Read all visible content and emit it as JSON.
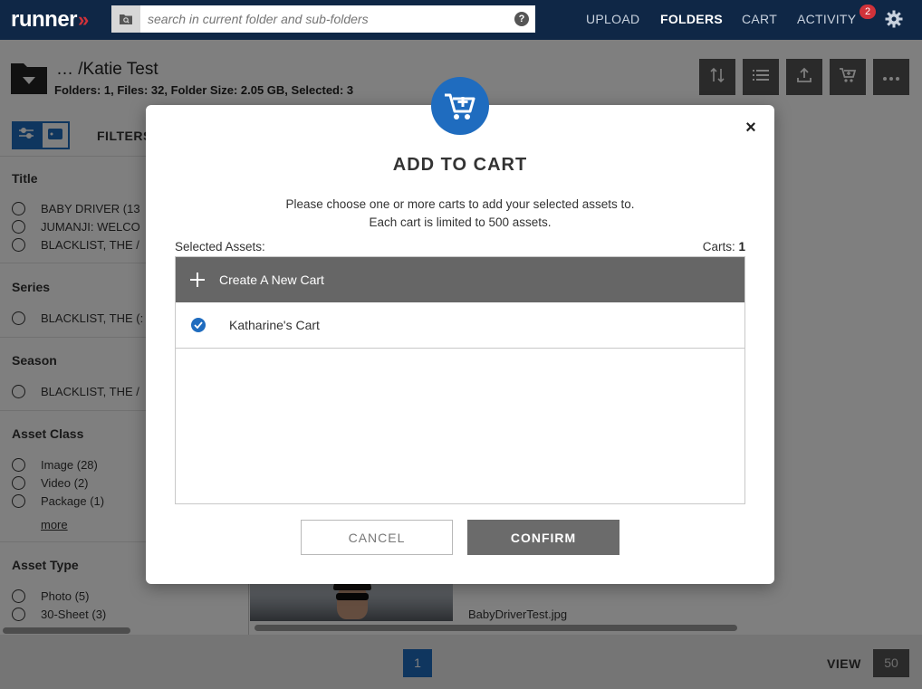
{
  "app": {
    "logo_text": "runner",
    "logo_chevrons": "»",
    "search_placeholder": "search in current folder and sub-folders",
    "search_help": "?",
    "nav": {
      "upload": "UPLOAD",
      "folders": "FOLDERS",
      "cart": "CART",
      "activity": "ACTIVITY",
      "activity_badge": "2"
    }
  },
  "header": {
    "path": "… /Katie Test",
    "stats": "Folders: 1, Files: 32, Folder Size: 2.05 GB, Selected: 3"
  },
  "sidebar": {
    "filters_label": "FILTERS",
    "facets": {
      "title": {
        "heading": "Title",
        "items": [
          "BABY DRIVER (13",
          "JUMANJI: WELCO",
          "BLACKLIST, THE /"
        ]
      },
      "series": {
        "heading": "Series",
        "items": [
          "BLACKLIST, THE (:"
        ]
      },
      "season": {
        "heading": "Season",
        "items": [
          "BLACKLIST, THE /"
        ]
      },
      "asset_class": {
        "heading": "Asset Class",
        "items": [
          "Image (28)",
          "Video (2)",
          "Package (1)"
        ],
        "more": "more"
      },
      "asset_type": {
        "heading": "Asset Type",
        "items": [
          "Photo (5)",
          "30-Sheet (3)"
        ]
      }
    }
  },
  "content": {
    "filename": "BabyDriverTest.jpg"
  },
  "footer": {
    "page": "1",
    "view_label": "VIEW",
    "view_value": "50"
  },
  "modal": {
    "title": "ADD TO CART",
    "desc_line1": "Please choose one or more carts to add your selected assets to.",
    "desc_line2": "Each cart is limited to 500 assets.",
    "selected_assets_label": "Selected Assets:",
    "carts_label": "Carts:",
    "carts_count": "1",
    "close_symbol": "×",
    "create_label": "Create A New Cart",
    "carts": [
      {
        "name": "Katharine's Cart",
        "selected": true
      }
    ],
    "cancel_label": "CANCEL",
    "confirm_label": "CONFIRM"
  },
  "colors": {
    "nav_bg": "#0f2746",
    "accent_blue": "#1f6cbf",
    "brand_red": "#d0323a",
    "button_gray": "#6b6b6b"
  },
  "icons": {
    "search_folder": "folder-search-icon",
    "help": "help-icon",
    "settings": "gear-icon",
    "folder": "folder-down-icon",
    "sort": "sort-arrows-icon",
    "list": "list-icon",
    "upload": "upload-icon",
    "cart": "cart-icon",
    "more": "more-icon",
    "filter": "sliders-icon",
    "tag": "tag-icon",
    "add_cart": "add-to-cart-icon",
    "close": "close-icon",
    "plus": "plus-icon",
    "check": "check-icon"
  }
}
